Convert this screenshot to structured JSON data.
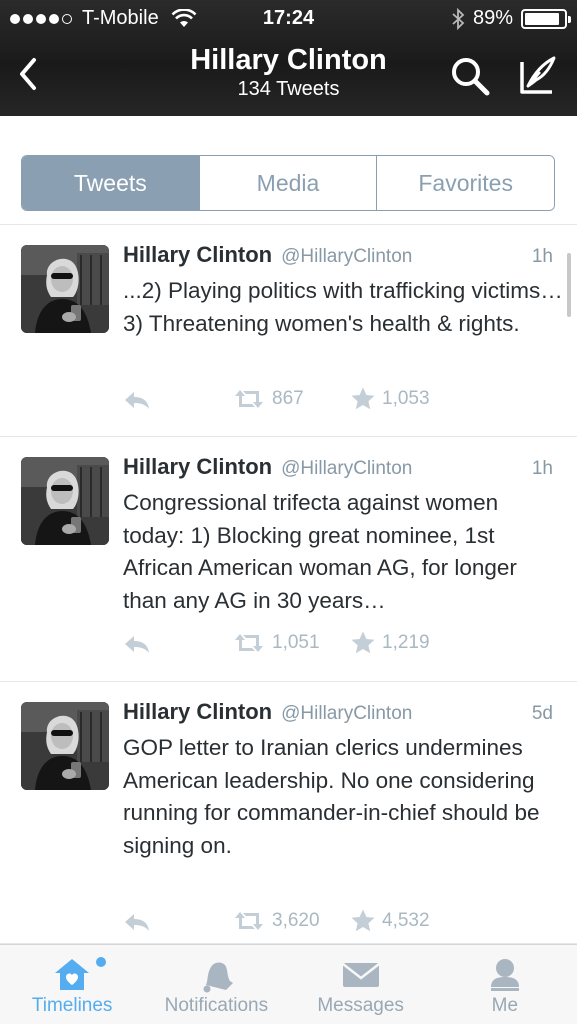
{
  "status_bar": {
    "carrier": "T-Mobile",
    "signal_bars": 4,
    "time": "17:24",
    "battery": "89%",
    "battery_level": 0.89
  },
  "nav": {
    "title": "Hillary Clinton",
    "subtitle": "134 Tweets"
  },
  "segments": [
    {
      "label": "Tweets",
      "active": true
    },
    {
      "label": "Media",
      "active": false
    },
    {
      "label": "Favorites",
      "active": false
    }
  ],
  "tweets": [
    {
      "name": "Hillary Clinton",
      "handle": "@HillaryClinton",
      "time": "1h",
      "text": "...2) Playing politics with trafficking victims… 3) Threatening women's health & rights.",
      "retweets": "867",
      "favorites": "1,053"
    },
    {
      "name": "Hillary Clinton",
      "handle": "@HillaryClinton",
      "time": "1h",
      "text": "Congressional trifecta against women today: 1) Blocking great nominee, 1st African American woman AG, for longer than any AG in 30 years…",
      "retweets": "1,051",
      "favorites": "1,219"
    },
    {
      "name": "Hillary Clinton",
      "handle": "@HillaryClinton",
      "time": "5d",
      "text": "GOP letter to Iranian clerics undermines American leadership.  No one considering running for commander-in-chief should be signing on.",
      "retweets": "3,620",
      "favorites": "4,532"
    }
  ],
  "tabbar": [
    {
      "label": "Timelines",
      "icon": "home-icon",
      "active": true
    },
    {
      "label": "Notifications",
      "icon": "bell-icon",
      "active": false
    },
    {
      "label": "Messages",
      "icon": "envelope-icon",
      "active": false
    },
    {
      "label": "Me",
      "icon": "person-icon",
      "active": false
    }
  ],
  "colors": {
    "accent": "#55acee",
    "segment": "#8aa0b2",
    "muted": "#8899a6"
  }
}
